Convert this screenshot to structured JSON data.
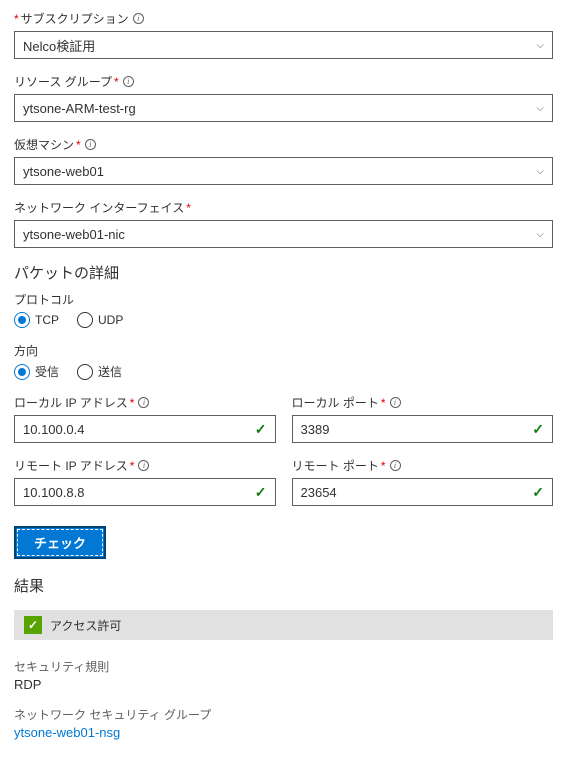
{
  "subscription": {
    "label": "サブスクリプション",
    "value": "Nelco検証用"
  },
  "resourceGroup": {
    "label": "リソース グループ",
    "value": "ytsone-ARM-test-rg"
  },
  "vm": {
    "label": "仮想マシン",
    "value": "ytsone-web01"
  },
  "nic": {
    "label": "ネットワーク インターフェイス",
    "value": "ytsone-web01-nic"
  },
  "packetDetails": {
    "title": "パケットの詳細"
  },
  "protocol": {
    "label": "プロトコル",
    "options": {
      "tcp": "TCP",
      "udp": "UDP"
    },
    "selected": "tcp"
  },
  "direction": {
    "label": "方向",
    "options": {
      "inbound": "受信",
      "outbound": "送信"
    },
    "selected": "inbound"
  },
  "localIp": {
    "label": "ローカル IP アドレス",
    "value": "10.100.0.4"
  },
  "localPort": {
    "label": "ローカル ポート",
    "value": "3389"
  },
  "remoteIp": {
    "label": "リモート IP アドレス",
    "value": "10.100.8.8"
  },
  "remotePort": {
    "label": "リモート ポート",
    "value": "23654"
  },
  "checkButton": "チェック",
  "results": {
    "title": "結果",
    "statusLabel": "アクセス許可",
    "ruleLabel": "セキュリティ規則",
    "ruleValue": "RDP",
    "nsgLabel": "ネットワーク セキュリティ グループ",
    "nsgValue": "ytsone-web01-nsg"
  }
}
